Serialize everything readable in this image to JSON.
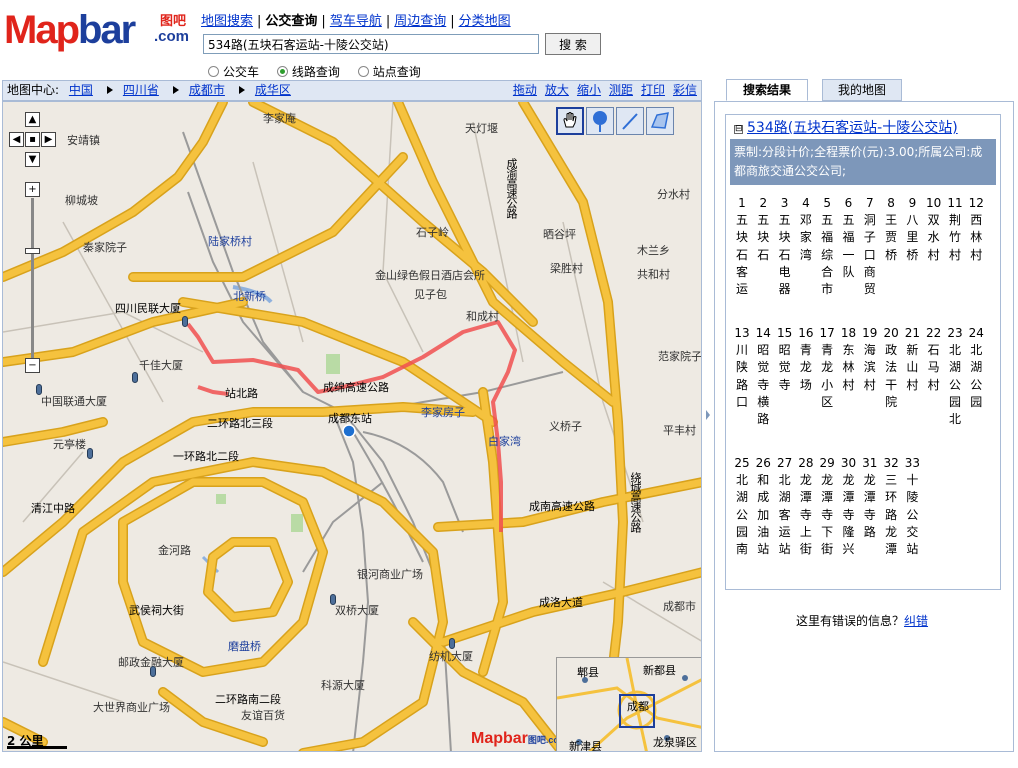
{
  "logo": {
    "brand_a": "Map",
    "brand_b": "bar",
    "cn": "图吧",
    "domain": ".com"
  },
  "nav": {
    "items": [
      {
        "label": "地图搜索",
        "current": false
      },
      {
        "label": "公交查询",
        "current": true
      },
      {
        "label": "驾车导航",
        "current": false
      },
      {
        "label": "周边查询",
        "current": false
      },
      {
        "label": "分类地图",
        "current": false
      }
    ],
    "separator": "|"
  },
  "search": {
    "value": "534路(五块石客运站-十陵公交站)",
    "button": "搜 索"
  },
  "search_modes": [
    {
      "label": "公交车",
      "selected": false
    },
    {
      "label": "线路查询",
      "selected": true
    },
    {
      "label": "站点查询",
      "selected": false
    }
  ],
  "map_header": {
    "label": "地图中心:",
    "crumbs": [
      "中国",
      "四川省",
      "成都市",
      "成华区"
    ],
    "tools": [
      "拖动",
      "放大",
      "缩小",
      "测距",
      "打印",
      "彩信"
    ]
  },
  "map": {
    "scale": "2 公里",
    "watermark": "Mapbar",
    "watermark_cn": "图吧",
    "watermark_com": ".com",
    "labels": {
      "anjing": "安靖镇",
      "lijiaan": "李家庵",
      "tiandeng": "天灯堰",
      "liuchengpo": "柳城坡",
      "qinjia": "秦家院子",
      "lujiaqiao": "陆家桥村",
      "shiziling": "石子岭",
      "qingupi": "晒谷坪",
      "fenshui": "分水村",
      "jinshan": "金山绿色假日酒店会所",
      "jianzibao": "见子包",
      "liangsheng": "梁胜村",
      "musanjiao": "木兰乡",
      "gongheng": "共和村",
      "bei_xiu": "北新桥",
      "beihai": "四川民联大厦",
      "heche": "和成村",
      "qianjia": "千佳大厦",
      "fanjia": "范家院子",
      "zhanbei": "站北路",
      "chengjin": "成绵高速公路",
      "sichuan_lt": "中国联通大厦",
      "chengdudong": "成都东站",
      "lijiafang": "李家房子",
      "yiqiaozi": "义桥子",
      "pingfeng": "平丰村",
      "baijiawan": "白家湾",
      "yuanting": "元亭楼",
      "erhuan_n": "二环路北三段",
      "yihuan_n": "一环路北二段",
      "qingjiangzhong": "清江中路",
      "jinhe": "金河路",
      "chengnan": "成南高速公路",
      "yinhe": "银河商业广场",
      "shuangqiao": "双桥大厦",
      "wuhou": "武侯祠大街",
      "moban": "磨盘桥",
      "chengdu_city": "成都市区",
      "youju": "邮政金融大厦",
      "fangzhi": "纺机大厦",
      "kehui": "科源大厦",
      "dashijie": "大世界商业广场",
      "erhuan_s": "二环路南二段",
      "youcheng": "友谊百货",
      "chengyu": "成渝高速公路",
      "chengluo": "成洛大道",
      "road_chengdu": "成都市",
      "jiancheng": "绕城高速公路"
    },
    "overview": {
      "pixian": "郫县",
      "xindu": "新都县",
      "chengdu": "成都",
      "xinjin": "新津县",
      "longquan": "龙泉驿区"
    }
  },
  "tabs": [
    {
      "label": "搜索结果",
      "active": true
    },
    {
      "label": "我的地图",
      "active": false
    }
  ],
  "result": {
    "toggle": "⊟",
    "title": "534路(五块石客运站-十陵公交站)",
    "info": "票制:分段计价;全程票价(元):3.00;所属公司:成都商旅交通公交公司;",
    "stops": [
      {
        "n": "1",
        "name": "五块石客运"
      },
      {
        "n": "2",
        "name": "五块石"
      },
      {
        "n": "3",
        "name": "五块石电器"
      },
      {
        "n": "4",
        "name": "邓家湾"
      },
      {
        "n": "5",
        "name": "五福综合市"
      },
      {
        "n": "6",
        "name": "五福一队"
      },
      {
        "n": "7",
        "name": "洞子口商贸"
      },
      {
        "n": "8",
        "name": "王贾桥"
      },
      {
        "n": "9",
        "name": "八里桥"
      },
      {
        "n": "10",
        "name": "双水村"
      },
      {
        "n": "11",
        "name": "荆竹村"
      },
      {
        "n": "12",
        "name": "西林村"
      },
      {
        "n": "13",
        "name": "川陕路口"
      },
      {
        "n": "14",
        "name": "昭觉寺横路"
      },
      {
        "n": "15",
        "name": "昭觉寺"
      },
      {
        "n": "16",
        "name": "青龙场"
      },
      {
        "n": "17",
        "name": "青龙小区"
      },
      {
        "n": "18",
        "name": "东林村"
      },
      {
        "n": "19",
        "name": "海滨村"
      },
      {
        "n": "20",
        "name": "政法干院"
      },
      {
        "n": "21",
        "name": "新山村"
      },
      {
        "n": "22",
        "name": "石马村"
      },
      {
        "n": "23",
        "name": "北湖公园北"
      },
      {
        "n": "24",
        "name": "北湖公园"
      },
      {
        "n": "25",
        "name": "北湖公园南"
      },
      {
        "n": "26",
        "name": "和成加油站"
      },
      {
        "n": "27",
        "name": "北湖客运站"
      },
      {
        "n": "28",
        "name": "龙潭寺上街"
      },
      {
        "n": "29",
        "name": "龙潭寺下街"
      },
      {
        "n": "30",
        "name": "龙潭寺隆兴"
      },
      {
        "n": "31",
        "name": "龙潭寺路"
      },
      {
        "n": "32",
        "name": "三环路龙潭"
      },
      {
        "n": "33",
        "name": "十陵公交站"
      }
    ]
  },
  "feedback": {
    "text": "这里有错误的信息？",
    "link": "纠错"
  },
  "colors": {
    "route": "#f05050",
    "road_major": "#f5c23e",
    "road_edge": "#d8a21c",
    "rail": "#9a9a9a",
    "info_bg": "#7d97ba",
    "brand_red": "#e0241b",
    "brand_blue": "#1d3f9c"
  }
}
